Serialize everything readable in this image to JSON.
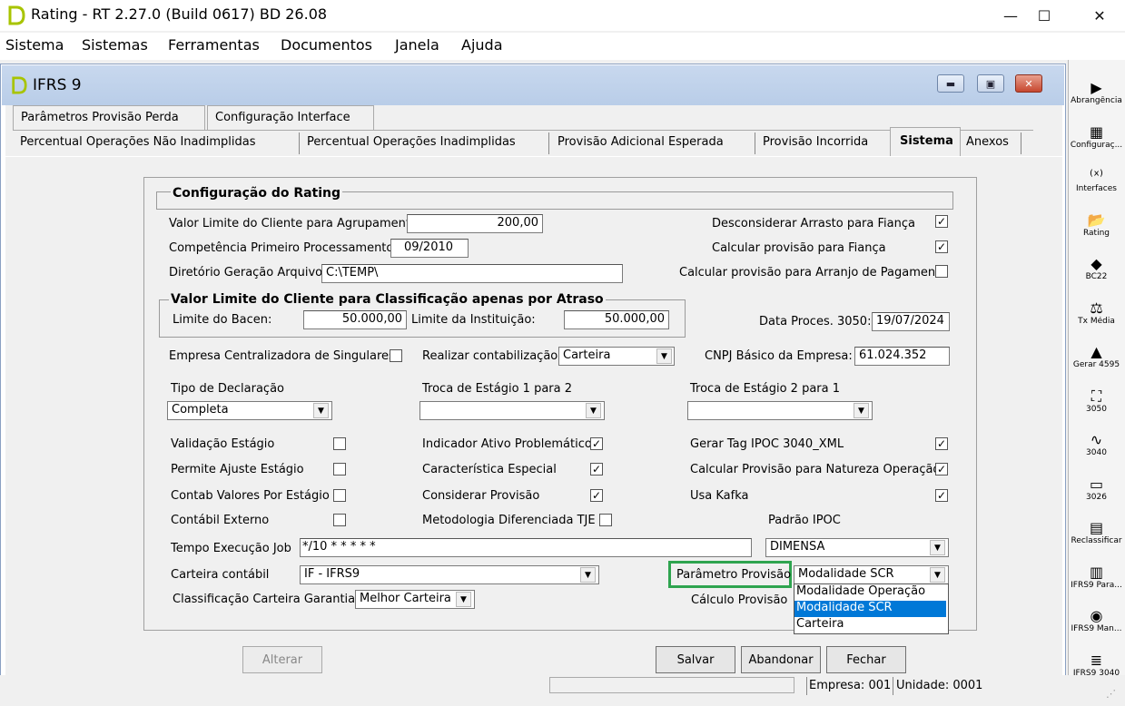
{
  "window": {
    "title": "Rating - RT 2.27.0 (Build 0617) BD 26.08",
    "minimize": "—",
    "maximize": "☐",
    "close": "✕"
  },
  "menu": [
    "Sistema",
    "Sistemas",
    "Ferramentas",
    "Documentos",
    "Janela",
    "Ajuda"
  ],
  "child_window": {
    "title": "IFRS 9"
  },
  "tabs_row1": [
    "Parâmetros Provisão Perda",
    "Configuração Interface"
  ],
  "tabs_row2": [
    "Percentual Operações Não Inadimplidas",
    "Percentual Operações Inadimplidas",
    "Provisão Adicional Esperada",
    "Provisão Incorrida",
    "Sistema",
    "Anexos"
  ],
  "active_tab": "Sistema",
  "config": {
    "group_title": "Configuração do Rating",
    "valor_limite_label": "Valor Limite do Cliente para Agrupamento:",
    "valor_limite_value": "200,00",
    "competencia_label": "Competência Primeiro Processamento:",
    "competencia_value": "09/2010",
    "diretorio_label": "Diretório Geração Arquivo:",
    "diretorio_value": "C:\\TEMP\\",
    "desconsiderar_label": "Desconsiderar Arrasto para Fiança",
    "desconsiderar_checked": "✓",
    "calc_fianca_label": "Calcular provisão para Fiança",
    "calc_fianca_checked": "✓",
    "calc_arranjo_label": "Calcular provisão para Arranjo de Pagamento",
    "calc_arranjo_checked": ""
  },
  "atraso": {
    "group_title": "Valor Limite do Cliente para Classificação apenas por Atraso",
    "bacen_label": "Limite do Bacen:",
    "bacen_value": "50.000,00",
    "instituicao_label": "Limite da Instituição:",
    "instituicao_value": "50.000,00",
    "data_proces_label": "Data Proces. 3050:",
    "data_proces_value": "19/07/2024"
  },
  "row_empresa": {
    "empresa_label": "Empresa Centralizadora de Singulares",
    "empresa_checked": "",
    "contab_label": "Realizar contabilização:",
    "contab_value": "Carteira",
    "cnpj_label": "CNPJ Básico da Empresa:",
    "cnpj_value": "61.024.352"
  },
  "declaracao": {
    "tipo_label": "Tipo de Declaração",
    "tipo_value": "Completa",
    "troca12_label": "Troca de Estágio 1 para 2",
    "troca12_value": "",
    "troca23_label": "Troca de Estágio 2 para 1",
    "troca23_value": ""
  },
  "checks": {
    "validacao_label": "Validação Estágio",
    "validacao": "",
    "permite_label": "Permite Ajuste Estágio",
    "permite": "",
    "contab_valores_label": "Contab Valores Por Estágio",
    "contab_valores": "",
    "contabil_externo_label": "Contábil Externo",
    "contabil_externo": "",
    "indicador_label": "Indicador Ativo Problemático",
    "indicador": "✓",
    "caracteristica_label": "Característica Especial",
    "caracteristica": "✓",
    "considerar_label": "Considerar Provisão",
    "considerar": "✓",
    "metodologia_label": "Metodologia Diferenciada TJE",
    "metodologia": "",
    "gerar_tag_label": "Gerar Tag IPOC 3040_XML",
    "gerar_tag": "✓",
    "calc_natureza_label": "Calcular Provisão para Natureza Operação",
    "calc_natureza": "✓",
    "kafka_label": "Usa Kafka",
    "kafka": "✓"
  },
  "ipoc": {
    "label": "Padrão IPOC",
    "value": "DIMENSA"
  },
  "job": {
    "label": "Tempo Execução Job",
    "value": "*/10 * * * * *"
  },
  "carteira": {
    "label": "Carteira contábil",
    "value": "IF - IFRS9"
  },
  "parametro": {
    "label": "Parâmetro Provisão",
    "value": "Modalidade SCR",
    "options": [
      "Modalidade Operação",
      "Modalidade SCR",
      "Carteira"
    ],
    "selected_index": 1
  },
  "garantias": {
    "label": "Classificação Carteira Garantias",
    "value": "Melhor Carteira"
  },
  "calculo": {
    "label": "Cálculo Provisão"
  },
  "buttons": {
    "alterar": "Alterar",
    "salvar": "Salvar",
    "abandonar": "Abandonar",
    "fechar": "Fechar"
  },
  "status": {
    "empresa": "Empresa: 001",
    "unidade": "Unidade: 0001"
  },
  "toolbar": [
    {
      "label": "Abrangência",
      "icon": "play-icon"
    },
    {
      "label": "Configuraç...",
      "icon": "grid-icon"
    },
    {
      "label": "Interfaces",
      "icon": "function-icon"
    },
    {
      "label": "Rating",
      "icon": "folder-icon"
    },
    {
      "label": "BC22",
      "icon": "cube-icon"
    },
    {
      "label": "Tx Média",
      "icon": "scale-icon"
    },
    {
      "label": "Gerar 4595",
      "icon": "warning-icon"
    },
    {
      "label": "3050",
      "icon": "network-icon"
    },
    {
      "label": "3040",
      "icon": "chart-icon"
    },
    {
      "label": "3026",
      "icon": "form-icon"
    },
    {
      "label": "Reclassificar",
      "icon": "table-icon"
    },
    {
      "label": "IFRS9 Para...",
      "icon": "list-icon"
    },
    {
      "label": "IFRS9 Man...",
      "icon": "globe-icon"
    },
    {
      "label": "IFRS9 3040",
      "icon": "database-icon"
    }
  ],
  "toolbar_glyphs": [
    "▶",
    "▦",
    "⁽ˣ⁾",
    "📂",
    "◆",
    "⚖",
    "▲",
    "⛶",
    "∿",
    "▭",
    "▤",
    "▥",
    "◉",
    "≣"
  ],
  "colors": {
    "highlight": "#0078d7",
    "green_box": "#2ea44f"
  }
}
